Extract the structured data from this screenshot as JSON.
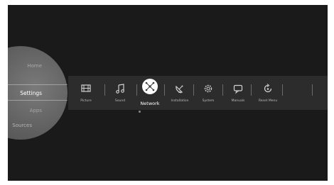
{
  "side_menu": {
    "items": [
      {
        "id": "home",
        "label": "Home"
      },
      {
        "id": "settings",
        "label": "Settings",
        "active": true
      },
      {
        "id": "apps",
        "label": "Apps"
      },
      {
        "id": "sources",
        "label": "Sources"
      }
    ]
  },
  "settings_menu": {
    "items": [
      {
        "id": "picture",
        "label": "Picture",
        "icon": "picture-icon"
      },
      {
        "id": "sound",
        "label": "Sound",
        "icon": "music-note-icon"
      },
      {
        "id": "network",
        "label": "Network",
        "icon": "network-icon",
        "selected": true
      },
      {
        "id": "installation",
        "label": "Installation",
        "icon": "satellite-dish-icon"
      },
      {
        "id": "system",
        "label": "System",
        "icon": "gear-icon"
      },
      {
        "id": "manuals",
        "label": "Manuals",
        "icon": "chat-bubble-icon"
      },
      {
        "id": "reset_menu",
        "label": "Reset Menu",
        "icon": "reset-icon"
      }
    ]
  },
  "colors": {
    "screen_background": "#1a1a1a",
    "menu_bar": "#2c2c2c",
    "selected_highlight": "#ffffff"
  }
}
